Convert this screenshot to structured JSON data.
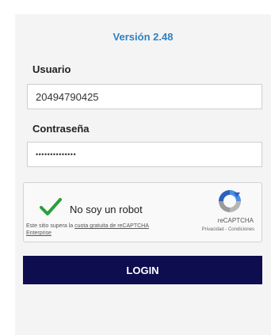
{
  "form": {
    "version": "Versión 2.48",
    "username_label": "Usuario",
    "username_value": "20494790425",
    "password_label": "Contraseña",
    "password_value": "••••••••••••••",
    "login_label": "LOGIN"
  },
  "captcha": {
    "checkbox_label": "No soy un robot",
    "checked": true,
    "quota_prefix": "Este sitio supera la",
    "quota_link": "cuota gratuita de reCAPTCHA Enterprise",
    "brand": "reCAPTCHA",
    "privacy": "Privacidad",
    "separator": " - ",
    "terms": "Condiciones",
    "icon": "recaptcha-logo-icon",
    "check_icon": "checkmark-icon"
  },
  "colors": {
    "accent": "#2f80c3",
    "button": "#0d0d4f",
    "check": "#2a9e3a"
  }
}
